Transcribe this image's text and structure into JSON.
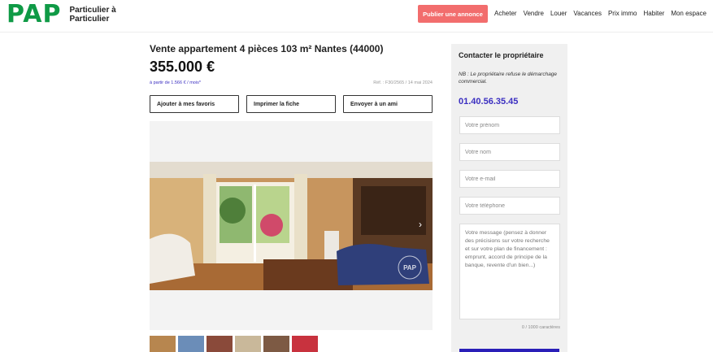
{
  "header": {
    "logo": "PAP",
    "logo_tagline": "Particulier à Particulier",
    "publish_label": "Publier une annonce",
    "nav": [
      "Acheter",
      "Vendre",
      "Louer",
      "Vacances",
      "Prix immo",
      "Habiter",
      "Mon espace"
    ]
  },
  "listing": {
    "title": "Vente appartement 4 pièces 103 m² Nantes (44000)",
    "price": "355.000 €",
    "monthly": "à partir de 1.566 € / mois*",
    "reference": "Réf. : F30/2565 / 14 mai 2024",
    "actions": [
      "Ajouter à mes favoris",
      "Imprimer la fiche",
      "Envoyer à un ami"
    ],
    "watermark": "PAP"
  },
  "contact": {
    "title": "Contacter le propriétaire",
    "note": "NB : Le propriétaire refuse le démarchage commercial.",
    "phone": "01.40.56.35.45",
    "placeholders": {
      "firstname": "Votre prénom",
      "lastname": "Votre nom",
      "email": "Votre e-mail",
      "phone": "Votre téléphone",
      "message": "Votre message (pensez à donner des précisions sur votre recherche et sur votre plan de financement : emprunt, accord de principe de la banque, revente d'un bien...)"
    },
    "counter": "0 / 1000 caractères"
  },
  "icons": {
    "gallery_next": "chevron-right-icon"
  }
}
